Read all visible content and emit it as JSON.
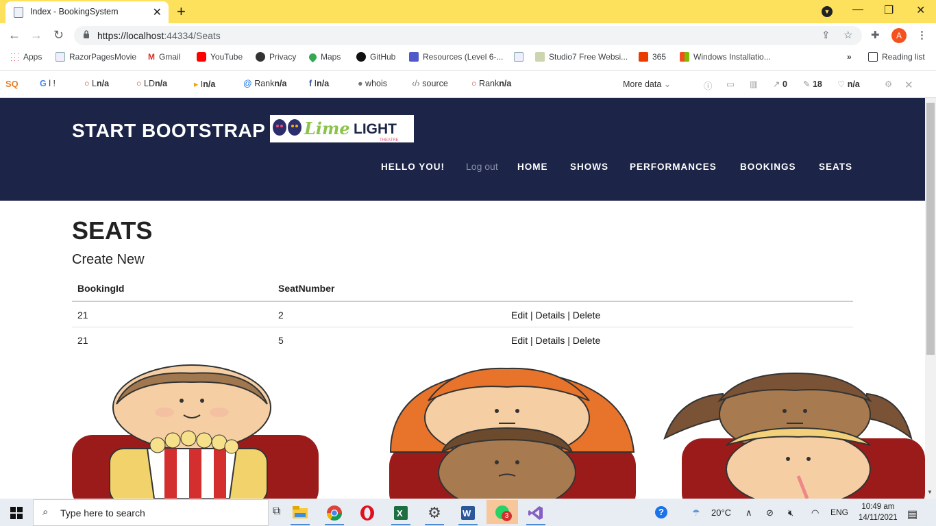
{
  "browser": {
    "tab_title": "Index - BookingSystem",
    "url_host": "https://localhost",
    "url_rest": ":44334/Seats",
    "profile_initial": "A"
  },
  "bookmarks": [
    {
      "label": "Apps"
    },
    {
      "label": "RazorPagesMovie"
    },
    {
      "label": "Gmail"
    },
    {
      "label": "YouTube"
    },
    {
      "label": "Privacy"
    },
    {
      "label": "Maps"
    },
    {
      "label": "GitHub"
    },
    {
      "label": "Resources (Level 6-..."
    },
    {
      "label": "Studio7 Free Websi..."
    },
    {
      "label": "365"
    },
    {
      "label": "Windows Installatio..."
    },
    {
      "label": "Reading list"
    }
  ],
  "seo_bar": {
    "g": "G",
    "g_val": "l  !",
    "l": "L",
    "l_val": "n/a",
    "ld": "LD",
    "ld_val": "n/a",
    "i": "I",
    "i_val": "n/a",
    "rank1": "Rank",
    "rank1_val": "n/a",
    "fb": "I",
    "fb_val": "n/a",
    "whois": "whois",
    "source": "source",
    "rank2": "Rank",
    "rank2_val": "n/a",
    "more": "More data",
    "count1": "0",
    "count2": "18",
    "count3": "n/a"
  },
  "site": {
    "brand": "START BOOTSTRAP",
    "logo_text": "LimeLIGHT",
    "logo_sub": "THEATRE",
    "nav": {
      "hello": "HELLO YOU!",
      "logout": "Log out",
      "home": "HOME",
      "shows": "SHOWS",
      "performances": "PERFORMANCES",
      "bookings": "BOOKINGS",
      "seats": "SEATS"
    }
  },
  "main": {
    "title": "SEATS",
    "create_new": "Create New",
    "columns": [
      "BookingId",
      "SeatNumber"
    ],
    "rows": [
      {
        "booking_id": "21",
        "seat_number": "2"
      },
      {
        "booking_id": "21",
        "seat_number": "5"
      }
    ],
    "actions": {
      "edit": "Edit",
      "details": "Details",
      "delete": "Delete",
      "sep": " | "
    }
  },
  "taskbar": {
    "search_placeholder": "Type here to search",
    "weather": "20°C",
    "lang": "ENG",
    "time": "10:49 am",
    "date": "14/11/2021",
    "whatsapp_badge": "3"
  }
}
